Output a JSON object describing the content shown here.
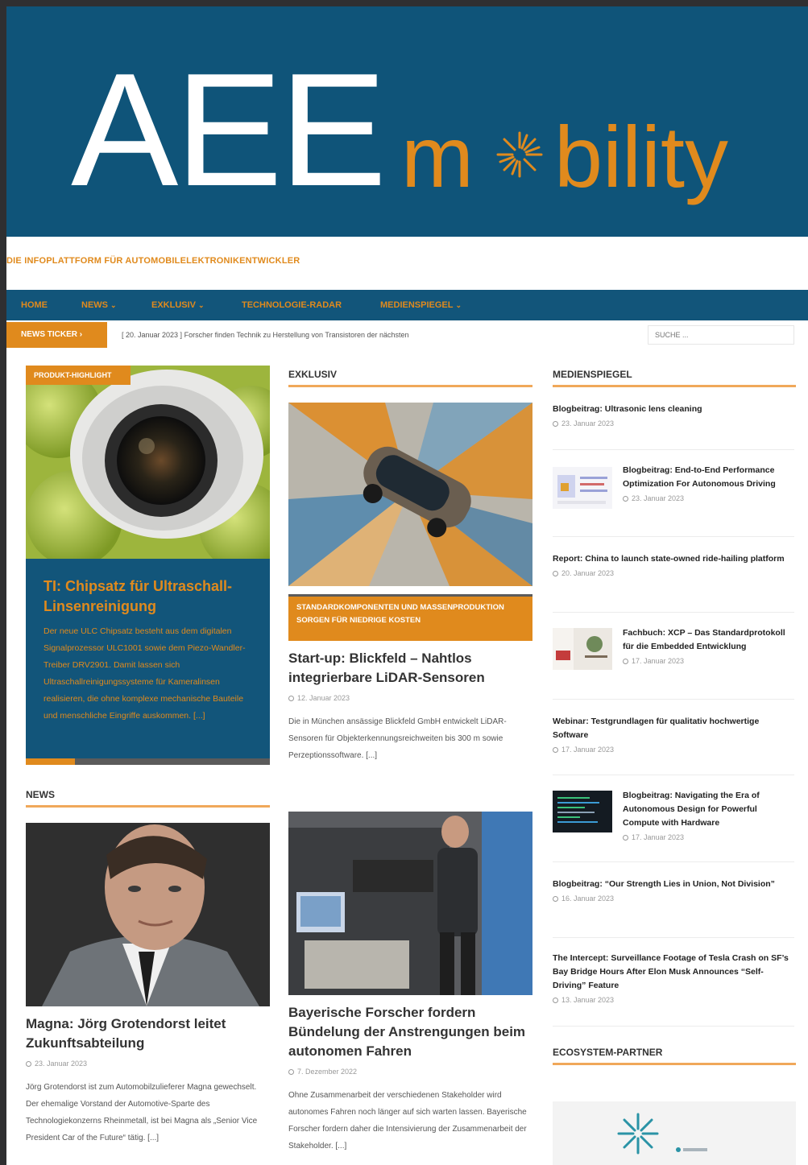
{
  "logo": {
    "word1": "AEE",
    "word2_part1": "m",
    "word2_part2": "bility"
  },
  "tagline": "DIE INFOPLATTFORM FÜR AUTOMOBILELEKTRONIKENTWICKLER",
  "nav": [
    {
      "label": "HOME"
    },
    {
      "label": "NEWS"
    },
    {
      "label": "EXKLUSIV"
    },
    {
      "label": "TECHNOLOGIE-RADAR"
    },
    {
      "label": "MEDIENSPIEGEL"
    }
  ],
  "ticker": {
    "label": "NEWS TICKER",
    "date": "[ 20. Januar 2023 ]",
    "text": "Forscher finden Technik zu Herstellung von Transistoren der nächsten"
  },
  "search": {
    "placeholder": "SUCHE ..."
  },
  "featured": {
    "badge": "PRODUKT-HIGHLIGHT",
    "title": "TI: Chipsatz für Ultraschall-Linsenreinigung",
    "text": "Der neue ULC Chipsatz besteht aus dem digitalen Signalprozessor ULC1001 sowie dem Piezo-Wandler-Treiber DRV2901. Damit lassen sich Ultraschallreinigungssysteme für Kameralinsen realisieren, die ohne komplexe mechanische Bauteile und menschliche Eingriffe auskommen. [...]",
    "slider_progress": 0.2
  },
  "sections": {
    "exklusiv": "EXKLUSIV",
    "medienspiegel": "MEDIENSPIEGEL",
    "news": "NEWS",
    "ecosystem": "ECOSYSTEM-PARTNER"
  },
  "exklusiv_article": {
    "category": "STANDARDKOMPONENTEN UND MASSENPRODUKTION SORGEN FÜR NIEDRIGE KOSTEN",
    "title": "Start-up: Blickfeld – Nahtlos integrierbare LiDAR-Sensoren",
    "date": "12. Januar 2023",
    "text": "Die in München ansässige Blickfeld GmbH entwickelt LiDAR-Sensoren für Objekterkennungsreichweiten bis 300 m sowie Perzeptionssoftware. [...]"
  },
  "news_article": {
    "title": "Magna: Jörg Grotendorst leitet Zukunftsabteilung",
    "date": "23. Januar 2023",
    "text": "Jörg Grotendorst ist zum Automobilzulieferer Magna gewechselt. Der ehemalige Vorstand der Automotive-Sparte des Technologiekonzerns Rheinmetall, ist bei Magna als „Senior Vice President Car of the Future“ tätig. [...]"
  },
  "second_article": {
    "title": "Bayerische Forscher fordern Bündelung der Anstrengungen beim autonomen Fahren",
    "date": "7. Dezember 2022",
    "text": "Ohne Zusammenarbeit der verschiedenen Stakeholder wird autonomes Fahren noch länger auf sich warten lassen. Bayerische Forscher fordern daher die Intensivierung der Zusammenarbeit der Stakeholder. [...]"
  },
  "medienspiegel": [
    {
      "title": "Blogbeitrag: Ultrasonic lens cleaning",
      "date": "23. Januar 2023"
    },
    {
      "title": "Blogbeitrag: End-to-End Performance Optimization For Autonomous Driving",
      "date": "23. Januar 2023"
    },
    {
      "title": "Report: China to launch state-owned ride-hailing platform",
      "date": "20. Januar 2023"
    },
    {
      "title": "Fachbuch: XCP – Das Standardprotokoll für die Embedded Entwicklung",
      "date": "17. Januar 2023"
    },
    {
      "title": "Webinar: Testgrundlagen für qualitativ hochwertige Software",
      "date": "17. Januar 2023"
    },
    {
      "title": "Blogbeitrag: Navigating the Era of Autonomous Design for Powerful Compute with Hardware",
      "date": "17. Januar 2023"
    },
    {
      "title": "Blogbeitrag: “Our Strength Lies in Union, Not Division”",
      "date": "16. Januar 2023"
    },
    {
      "title": "The Intercept: Surveillance Footage of Tesla Crash on SF’s Bay Bridge Hours After Elon Musk Announces “Self-Driving” Feature",
      "date": "13. Januar 2023"
    }
  ],
  "colors": {
    "brand_blue": "#12557a",
    "accent_orange": "#e08a1d"
  }
}
